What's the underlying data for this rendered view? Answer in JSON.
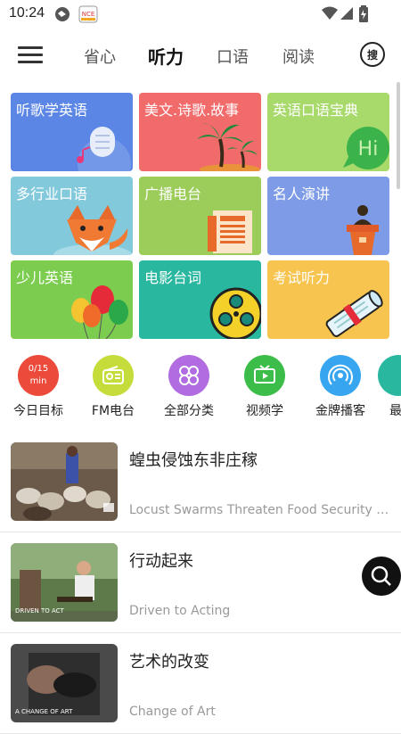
{
  "status_bar": {
    "time": "10:24",
    "app_badge": "NCE"
  },
  "nav": {
    "tabs": [
      {
        "label": "省心",
        "active": false
      },
      {
        "label": "听力",
        "active": true
      },
      {
        "label": "口语",
        "active": false
      },
      {
        "label": "阅读",
        "active": false
      }
    ],
    "search_label": "搜"
  },
  "categories": [
    {
      "label": "听歌学英语",
      "color": "#5b86e5",
      "icon": "microphone-music-icon"
    },
    {
      "label": "美文.诗歌.故事",
      "color": "#f26b6b",
      "icon": "palm-tree-icon"
    },
    {
      "label": "英语口语宝典",
      "color": "#a8d96b",
      "icon": "hi-chat-bubble-icon"
    },
    {
      "label": "多行业口语",
      "color": "#83c9dc",
      "icon": "fox-icon"
    },
    {
      "label": "广播电台",
      "color": "#9ccc5a",
      "icon": "newspaper-icon"
    },
    {
      "label": "名人演讲",
      "color": "#7d9be6",
      "icon": "podium-icon"
    },
    {
      "label": "少儿英语",
      "color": "#7ccd4f",
      "icon": "balloons-icon"
    },
    {
      "label": "电影台词",
      "color": "#2ab7a0",
      "icon": "film-reel-icon"
    },
    {
      "label": "考试听力",
      "color": "#f6c44f",
      "icon": "diploma-icon"
    }
  ],
  "quick_actions": [
    {
      "label": "今日目标",
      "color": "#ec4a3b",
      "inner": "0/15\nmin",
      "icon": "target-progress-icon"
    },
    {
      "label": "FM电台",
      "color": "#c5dc3a",
      "inner": "",
      "icon": "radio-icon"
    },
    {
      "label": "全部分类",
      "color": "#b06ce0",
      "inner": "",
      "icon": "clover-icon"
    },
    {
      "label": "视频学",
      "color": "#3cbd4a",
      "inner": "",
      "icon": "tv-icon"
    },
    {
      "label": "金牌播客",
      "color": "#37a5ef",
      "inner": "",
      "icon": "podcast-icon"
    },
    {
      "label": "最",
      "color": "#2ab7a0",
      "inner": "",
      "icon": "more-icon"
    }
  ],
  "articles": [
    {
      "title": "蝗虫侵蚀东非庄稼",
      "subtitle": "Locust Swarms Threaten Food Security in ...",
      "thumb_caption": ""
    },
    {
      "title": "行动起来",
      "subtitle": "Driven to Acting",
      "thumb_caption": "DRIVEN TO ACT"
    },
    {
      "title": "艺术的改变",
      "subtitle": "Change of Art",
      "thumb_caption": "A CHANGE OF ART"
    }
  ]
}
